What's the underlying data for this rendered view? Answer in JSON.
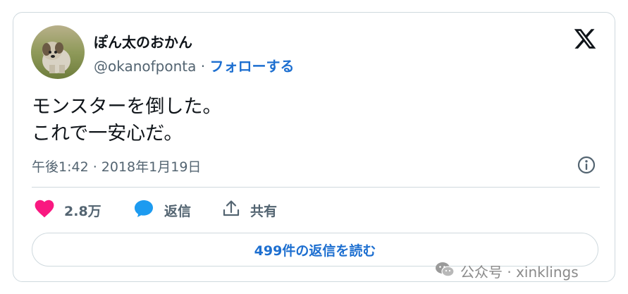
{
  "tweet": {
    "display_name": "ぽん太のおかん",
    "handle": "@okanofponta",
    "separator": "·",
    "follow_label": "フォローする",
    "text_lines": [
      "モンスターを倒した。",
      "これで一安心だ。"
    ],
    "timestamp": "午後1:42 · 2018年1月19日",
    "like_count": "2.8万",
    "reply_label": "返信",
    "share_label": "共有",
    "read_replies_label": "499件の返信を読む"
  },
  "icons": {
    "brand": "x-logo-icon",
    "info": "info-icon",
    "like": "heart-icon",
    "reply": "speech-bubble-icon",
    "share": "share-icon"
  },
  "colors": {
    "text": "#0f1419",
    "secondary": "#536471",
    "link": "#1d6fd0",
    "like": "#f91880",
    "reply": "#1d9bf0",
    "border": "#cfd9de"
  },
  "watermark": {
    "text": "公众号 · xinklings"
  }
}
